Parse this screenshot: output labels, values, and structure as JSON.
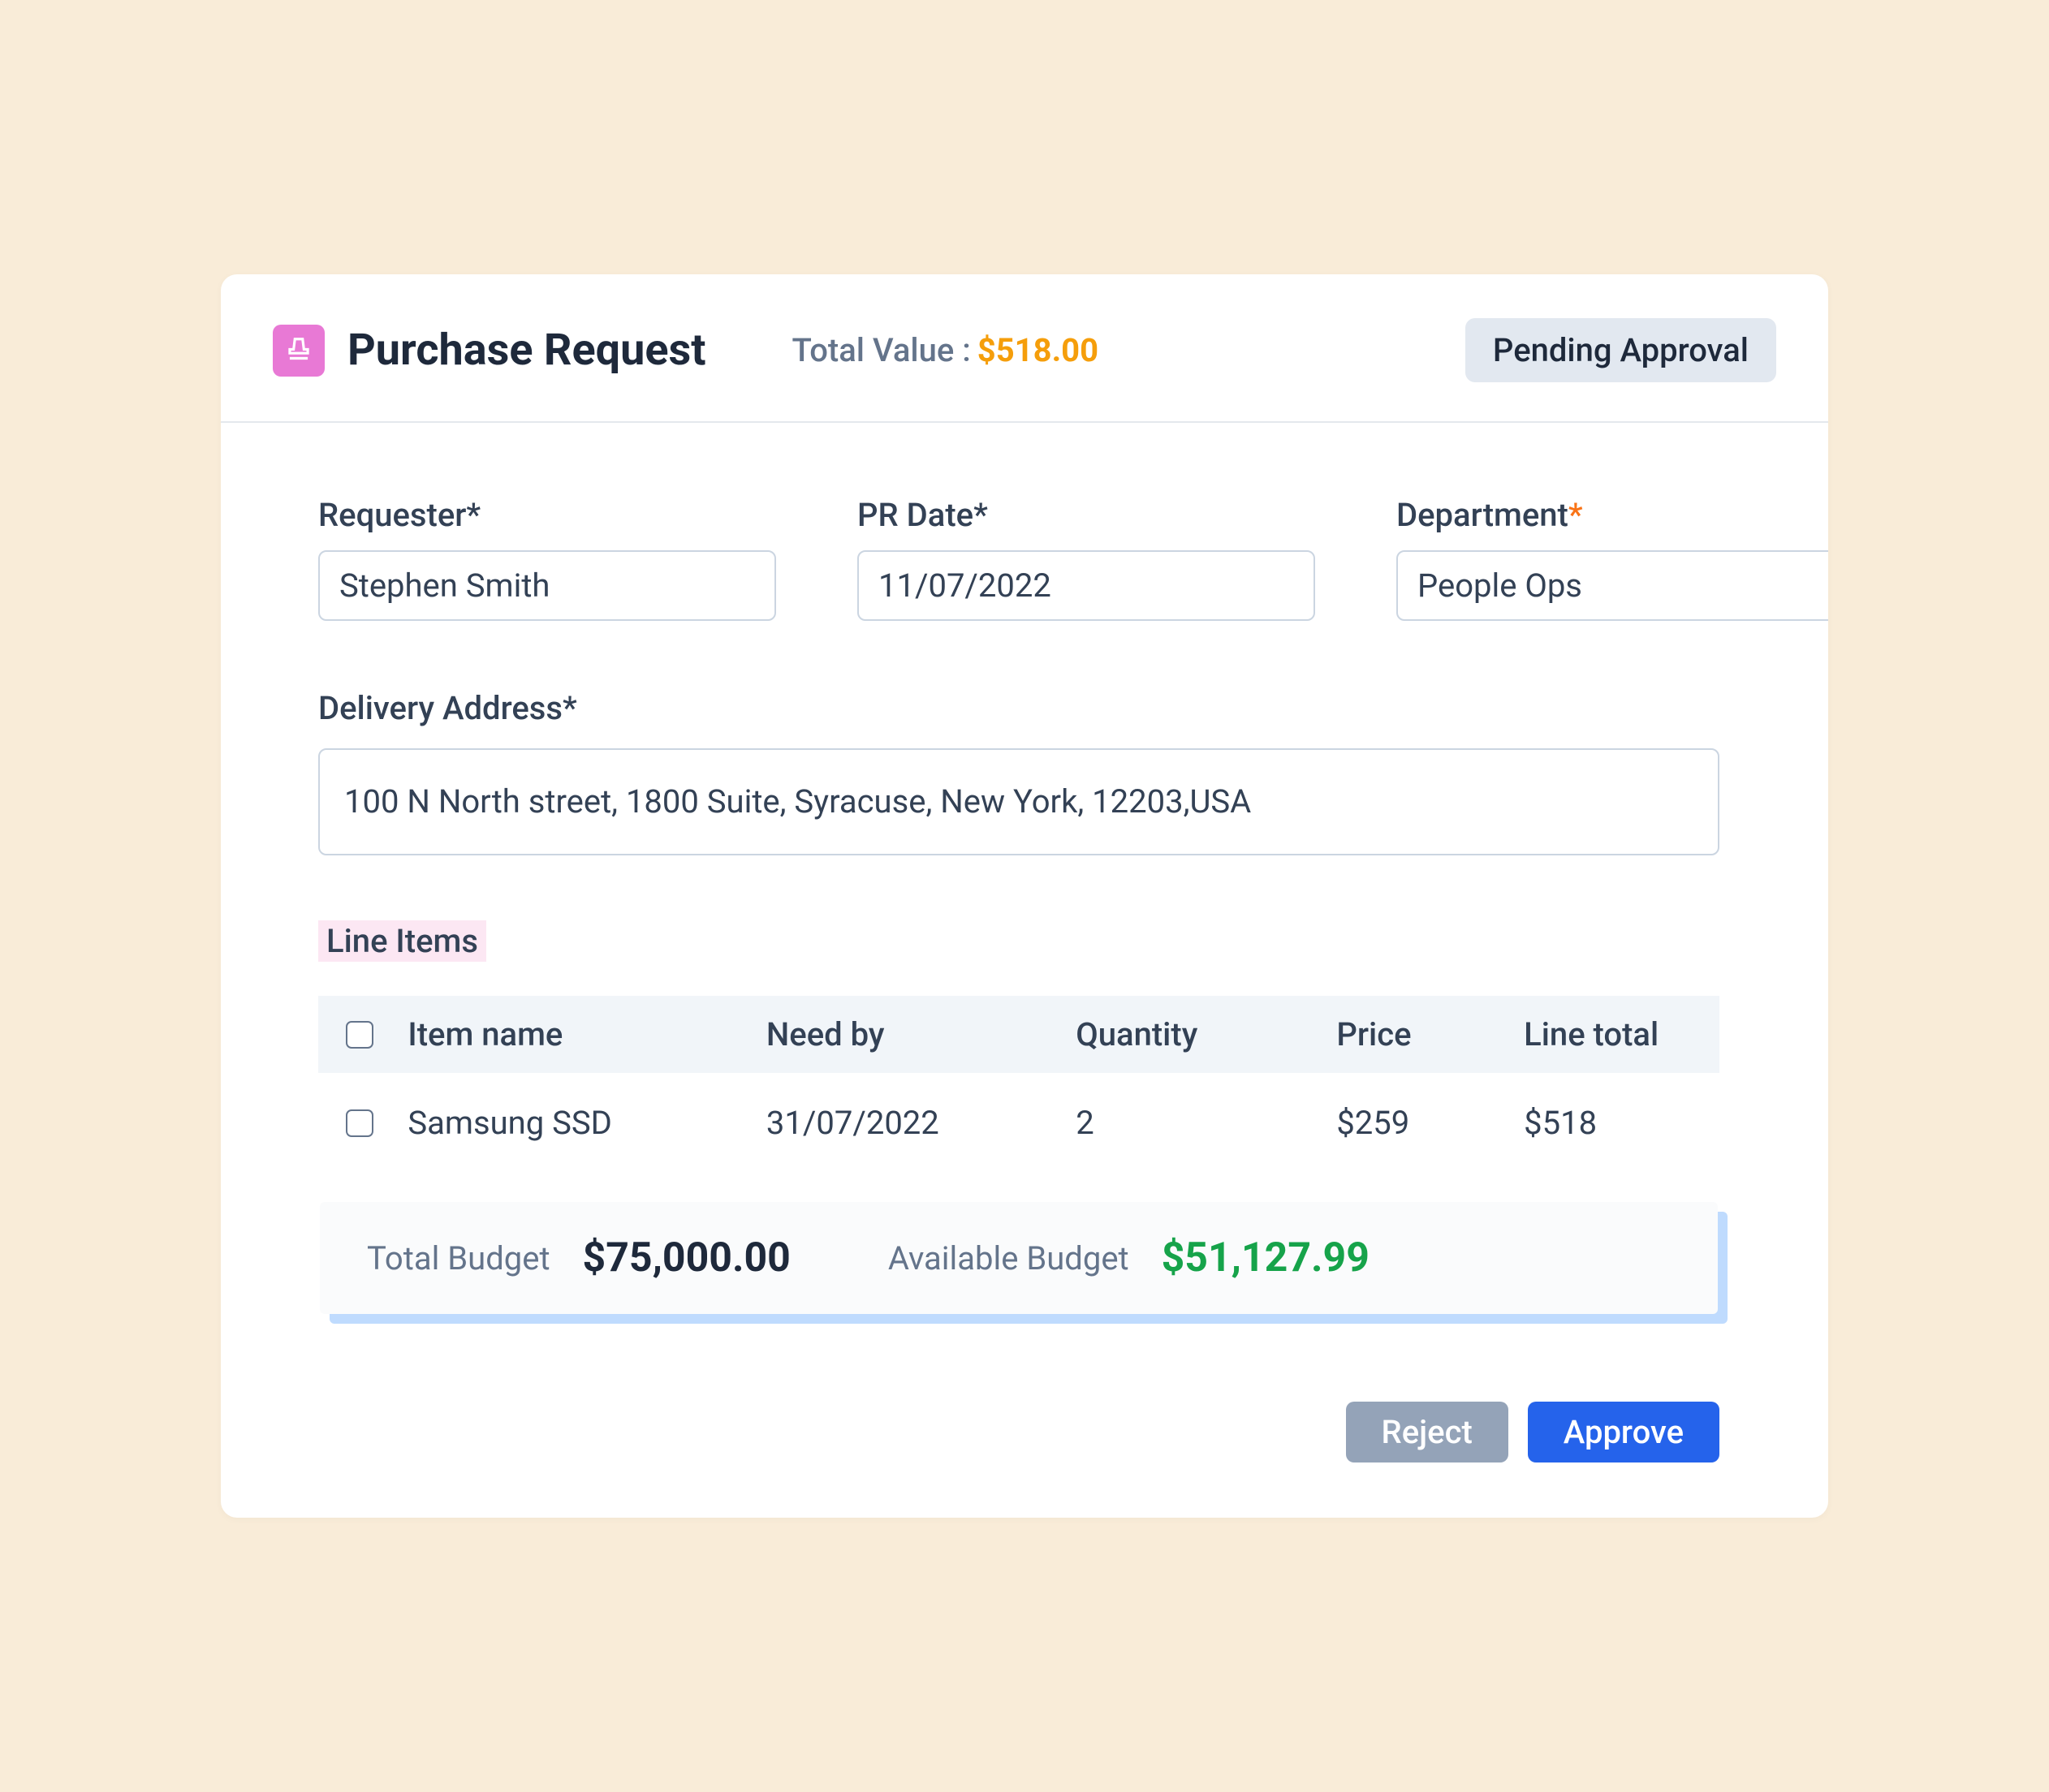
{
  "header": {
    "title": "Purchase Request",
    "total_label": "Total Value : ",
    "total_value": "$518.00",
    "status": "Pending Approval"
  },
  "form": {
    "requester_label": "Requester*",
    "requester_value": "Stephen Smith",
    "date_label": "PR Date*",
    "date_value": "11/07/2022",
    "department_label": "Department",
    "department_value": "People Ops",
    "address_label": "Delivery Address*",
    "address_value": "100 N North street, 1800 Suite, Syracuse, New York, 12203,USA"
  },
  "line_items": {
    "section_title": "Line Items",
    "columns": {
      "name": "Item name",
      "need_by": "Need by",
      "quantity": "Quantity",
      "price": "Price",
      "line_total": "Line total"
    },
    "rows": [
      {
        "name": "Samsung SSD",
        "need_by": "31/07/2022",
        "quantity": "2",
        "price": "$259",
        "line_total": "$518"
      }
    ]
  },
  "budget": {
    "total_label": "Total Budget",
    "total_value": "$75,000.00",
    "available_label": "Available Budget",
    "available_value": "$51,127.99"
  },
  "actions": {
    "reject": "Reject",
    "approve": "Approve"
  }
}
